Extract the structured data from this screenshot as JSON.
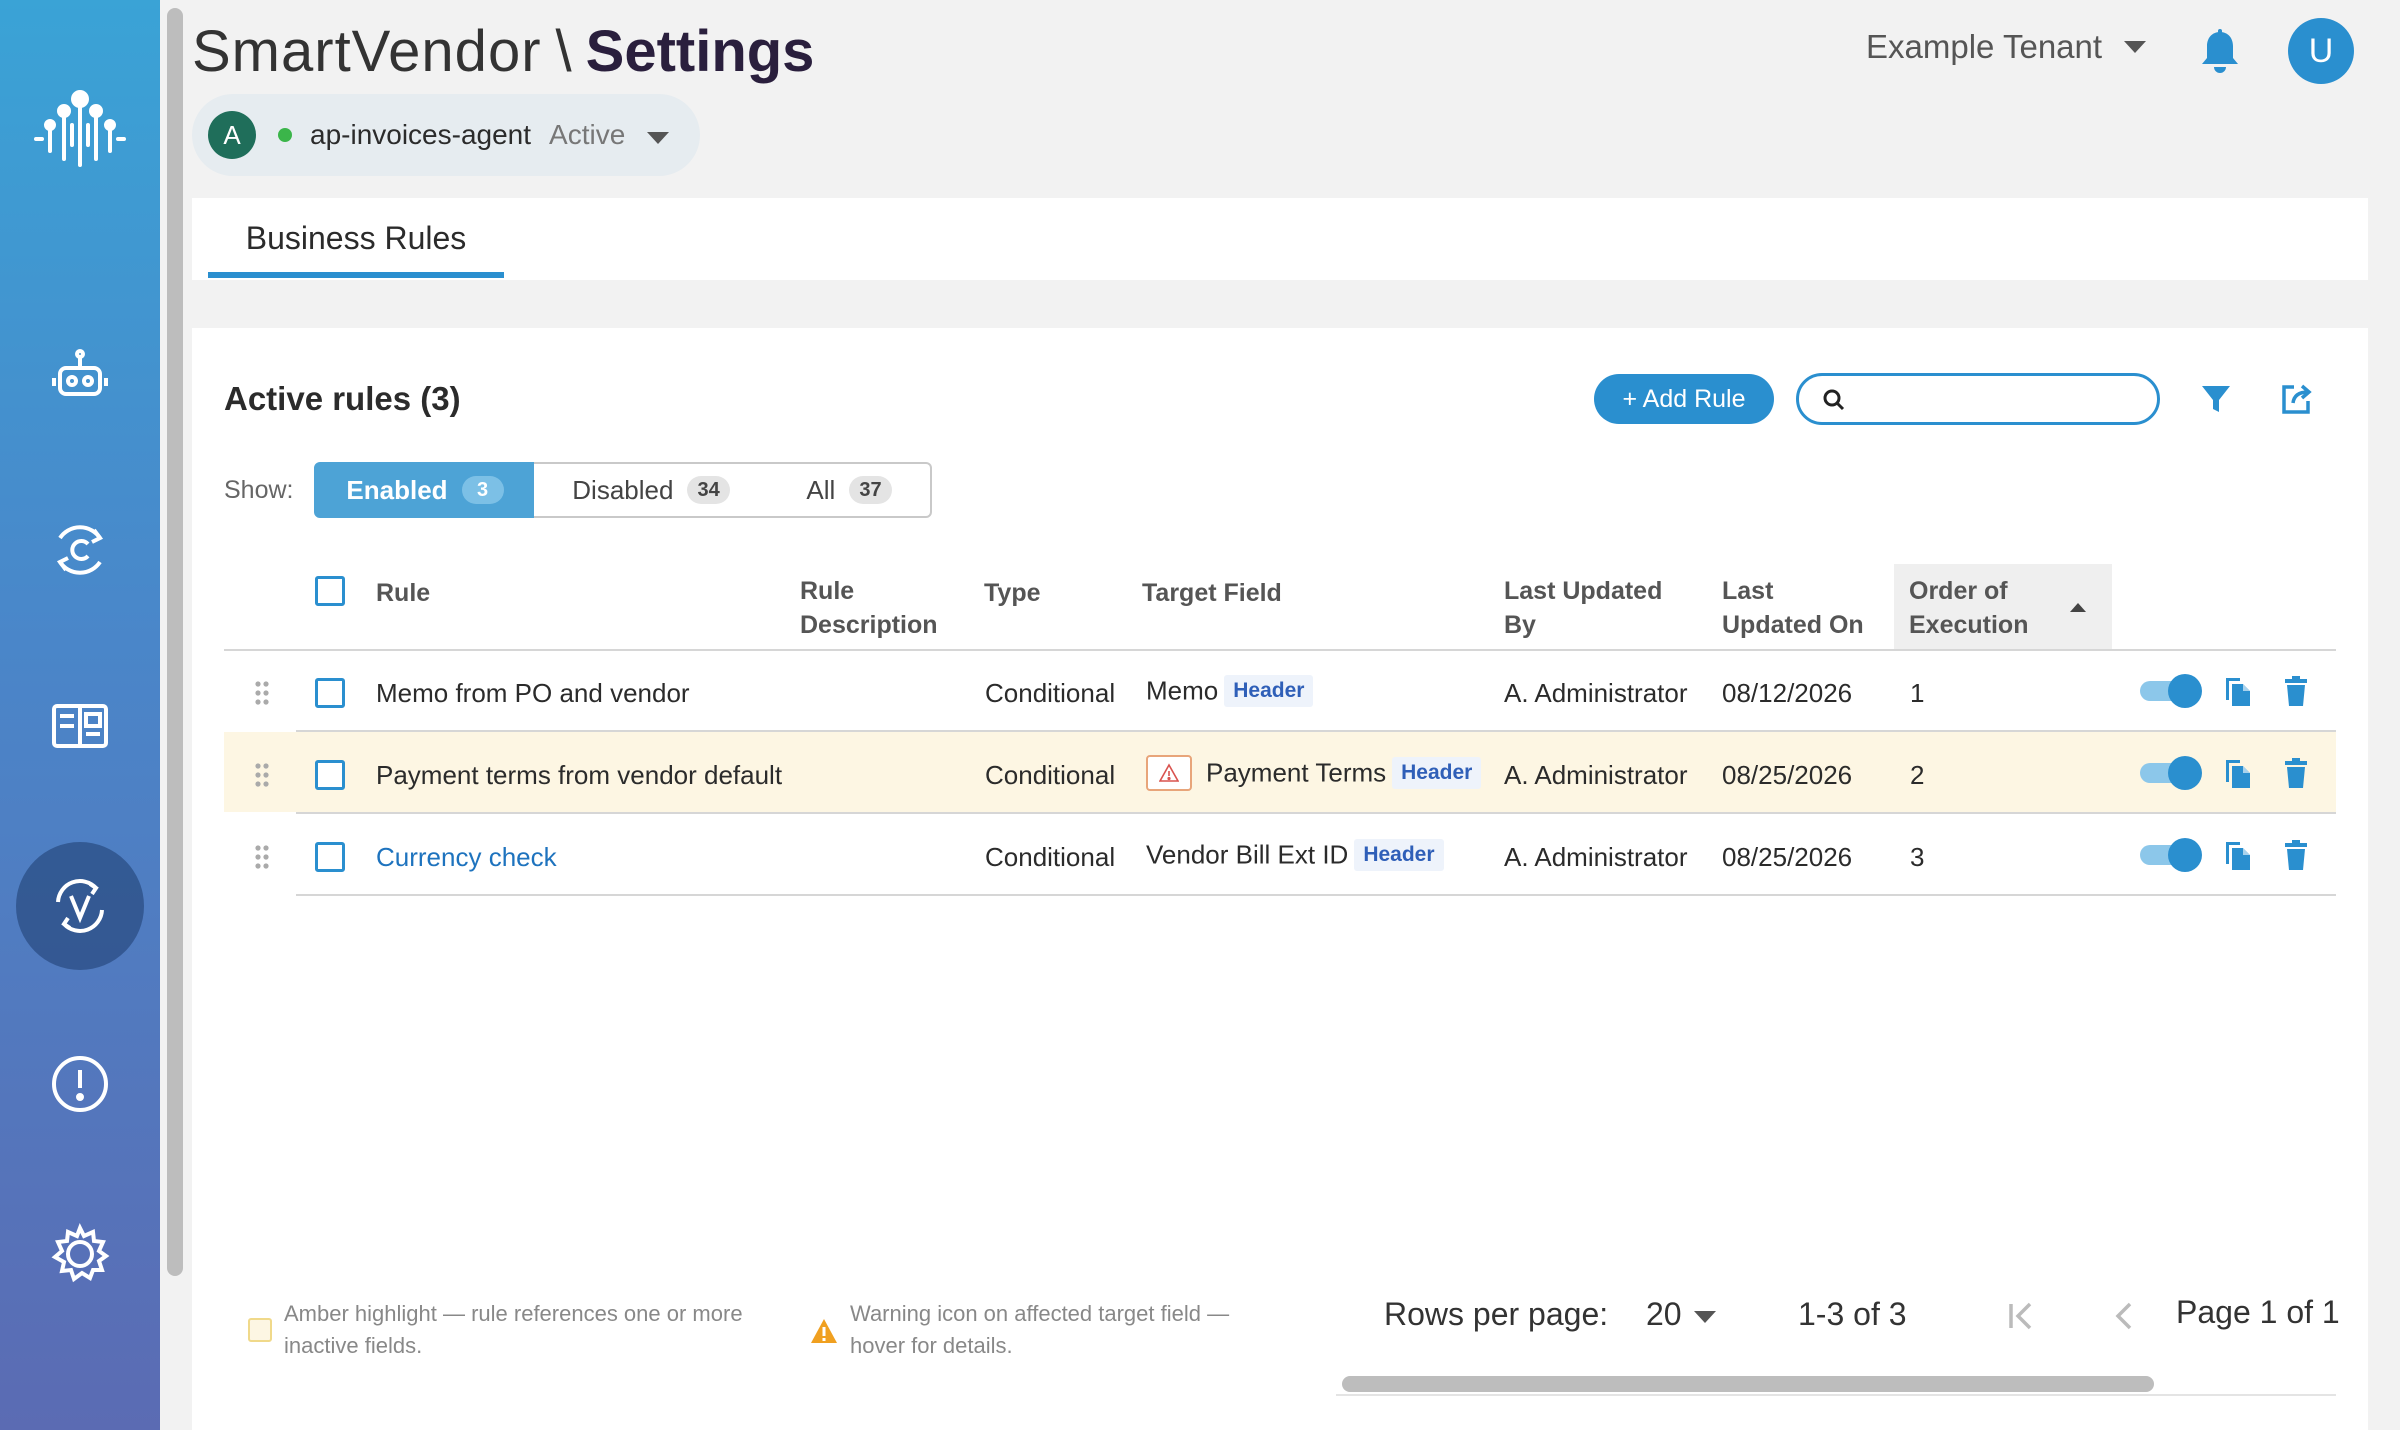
{
  "header": {
    "app_name": "SmartVendor",
    "separator": "\\",
    "page_title": "Settings",
    "tenant": "Example Tenant",
    "user_initial": "U"
  },
  "agent": {
    "initial": "A",
    "name": "ap-invoices-agent",
    "status": "Active"
  },
  "sidebar": {
    "items": [
      {
        "name": "agents",
        "icon": "robot-icon"
      },
      {
        "name": "connections",
        "icon": "sync-c-icon"
      },
      {
        "name": "catalog",
        "icon": "book-icon"
      },
      {
        "name": "validation",
        "icon": "v-sync-icon",
        "active": true
      },
      {
        "name": "alerts",
        "icon": "alert-icon"
      },
      {
        "name": "settings",
        "icon": "gear-icon"
      }
    ]
  },
  "tabs": [
    {
      "label": "Business Rules",
      "active": true
    }
  ],
  "rules_section": {
    "title": "Active rules (3)",
    "add_button": "+ Add Rule",
    "search_placeholder": "",
    "show_label": "Show:",
    "filters": [
      {
        "label": "Enabled",
        "count": "3",
        "selected": true
      },
      {
        "label": "Disabled",
        "count": "34",
        "selected": false
      },
      {
        "label": "All",
        "count": "37",
        "selected": false
      }
    ]
  },
  "table": {
    "headers": {
      "rule": "Rule",
      "description_1": "Rule",
      "description_2": "Description",
      "type": "Type",
      "target": "Target Field",
      "updated_by_1": "Last Updated",
      "updated_by_2": "By",
      "updated_on_1": "Last",
      "updated_on_2": "Updated On",
      "order_1": "Order of",
      "order_2": "Execution"
    },
    "rows": [
      {
        "rule": "Memo from PO and vendor",
        "description": "",
        "type": "Conditional",
        "target": "Memo",
        "target_tag": "Header",
        "warning": false,
        "updated_by": "A. Administrator",
        "updated_on": "08/12/2026",
        "order": "1",
        "enabled": true,
        "highlight": false,
        "link": false
      },
      {
        "rule": "Payment terms from vendor default",
        "description": "",
        "type": "Conditional",
        "target": "Payment Terms",
        "target_tag": "Header",
        "warning": true,
        "updated_by": "A. Administrator",
        "updated_on": "08/25/2026",
        "order": "2",
        "enabled": true,
        "highlight": true,
        "link": false
      },
      {
        "rule": "Currency check",
        "description": "",
        "type": "Conditional",
        "target": "Vendor Bill Ext ID",
        "target_tag": "Header",
        "warning": false,
        "updated_by": "A. Administrator",
        "updated_on": "08/25/2026",
        "order": "3",
        "enabled": true,
        "highlight": false,
        "link": true
      }
    ]
  },
  "legend": {
    "amber_1": "Amber highlight — rule references one or more",
    "amber_2": "inactive fields.",
    "warn_1": "Warning icon on affected target field —",
    "warn_2": "hover for details."
  },
  "pagination": {
    "rows_per_page_label": "Rows per page:",
    "rows_per_page": "20",
    "range": "1-3 of 3",
    "page": "Page 1 of 1"
  },
  "colors": {
    "accent": "#2a8fcf",
    "highlight_row": "#fdf6e3",
    "status_active": "#3bb54a"
  }
}
